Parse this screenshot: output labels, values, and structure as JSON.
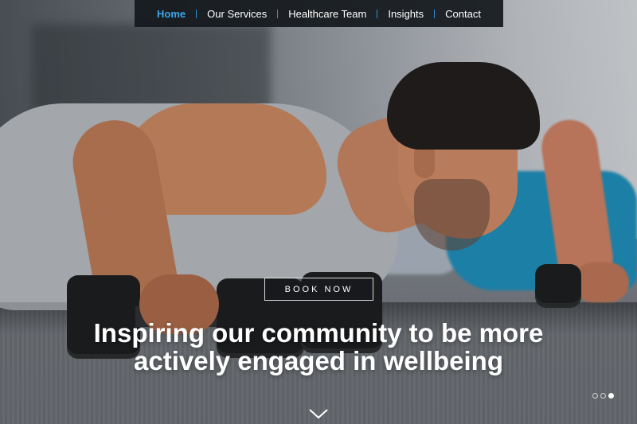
{
  "nav": {
    "items": [
      {
        "label": "Home",
        "active": true
      },
      {
        "label": "Our Services",
        "active": false
      },
      {
        "label": "Healthcare Team",
        "active": false
      },
      {
        "label": "Insights",
        "active": false
      },
      {
        "label": "Contact",
        "active": false
      }
    ]
  },
  "hero": {
    "cta_label": "BOOK NOW",
    "headline_line1": "Inspiring our community to be more",
    "headline_line2": "actively engaged in wellbeing",
    "slides_total": 3,
    "slide_active": 3,
    "scroll_icon": "chevron-down-icon"
  },
  "colors": {
    "accent": "#3aa6e8",
    "nav_bg": "#14181c",
    "text": "#ffffff"
  }
}
